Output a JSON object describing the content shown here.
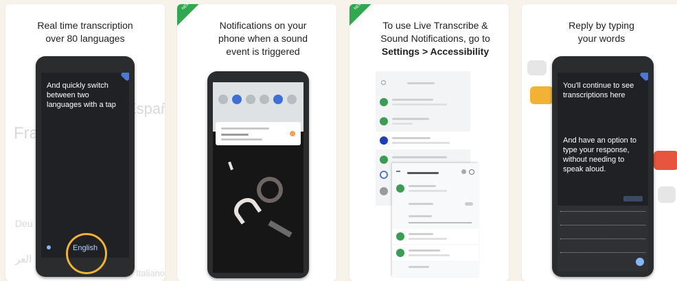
{
  "cards": [
    {
      "caption": [
        "Real time transcription",
        "over 80 languages"
      ],
      "phone_text": [
        "And quickly switch",
        "between two",
        "languages with a tap"
      ],
      "language_button": "English",
      "background_words": [
        "Fra",
        "Españ",
        "Deu",
        "العر",
        "Italiano"
      ]
    },
    {
      "caption": [
        "Notifications on your",
        "phone when a sound",
        "event is triggered"
      ]
    },
    {
      "caption_plain": [
        "To use Live Transcribe &",
        "Sound Notifications, go to"
      ],
      "caption_bold": "Settings > Accessibility"
    },
    {
      "caption": [
        "Reply by typing",
        "your words"
      ],
      "phone_text_1": [
        "You'll continue to see",
        "transcriptions here"
      ],
      "phone_text_2": [
        "And have an option to",
        "type your response,",
        "without needing to",
        "speak aloud."
      ]
    }
  ],
  "colors": {
    "page_bg": "#f7f2ea",
    "accent_green": "#2fa84f",
    "highlight_ring": "#f2b233",
    "phone_body": "#2b2c2e",
    "screen_dark": "#202124",
    "link_blue": "#4c78d8"
  },
  "icons": [
    "new-ribbon",
    "chat-bubble-icon",
    "settings-gear-icon",
    "accessibility-icon"
  ]
}
